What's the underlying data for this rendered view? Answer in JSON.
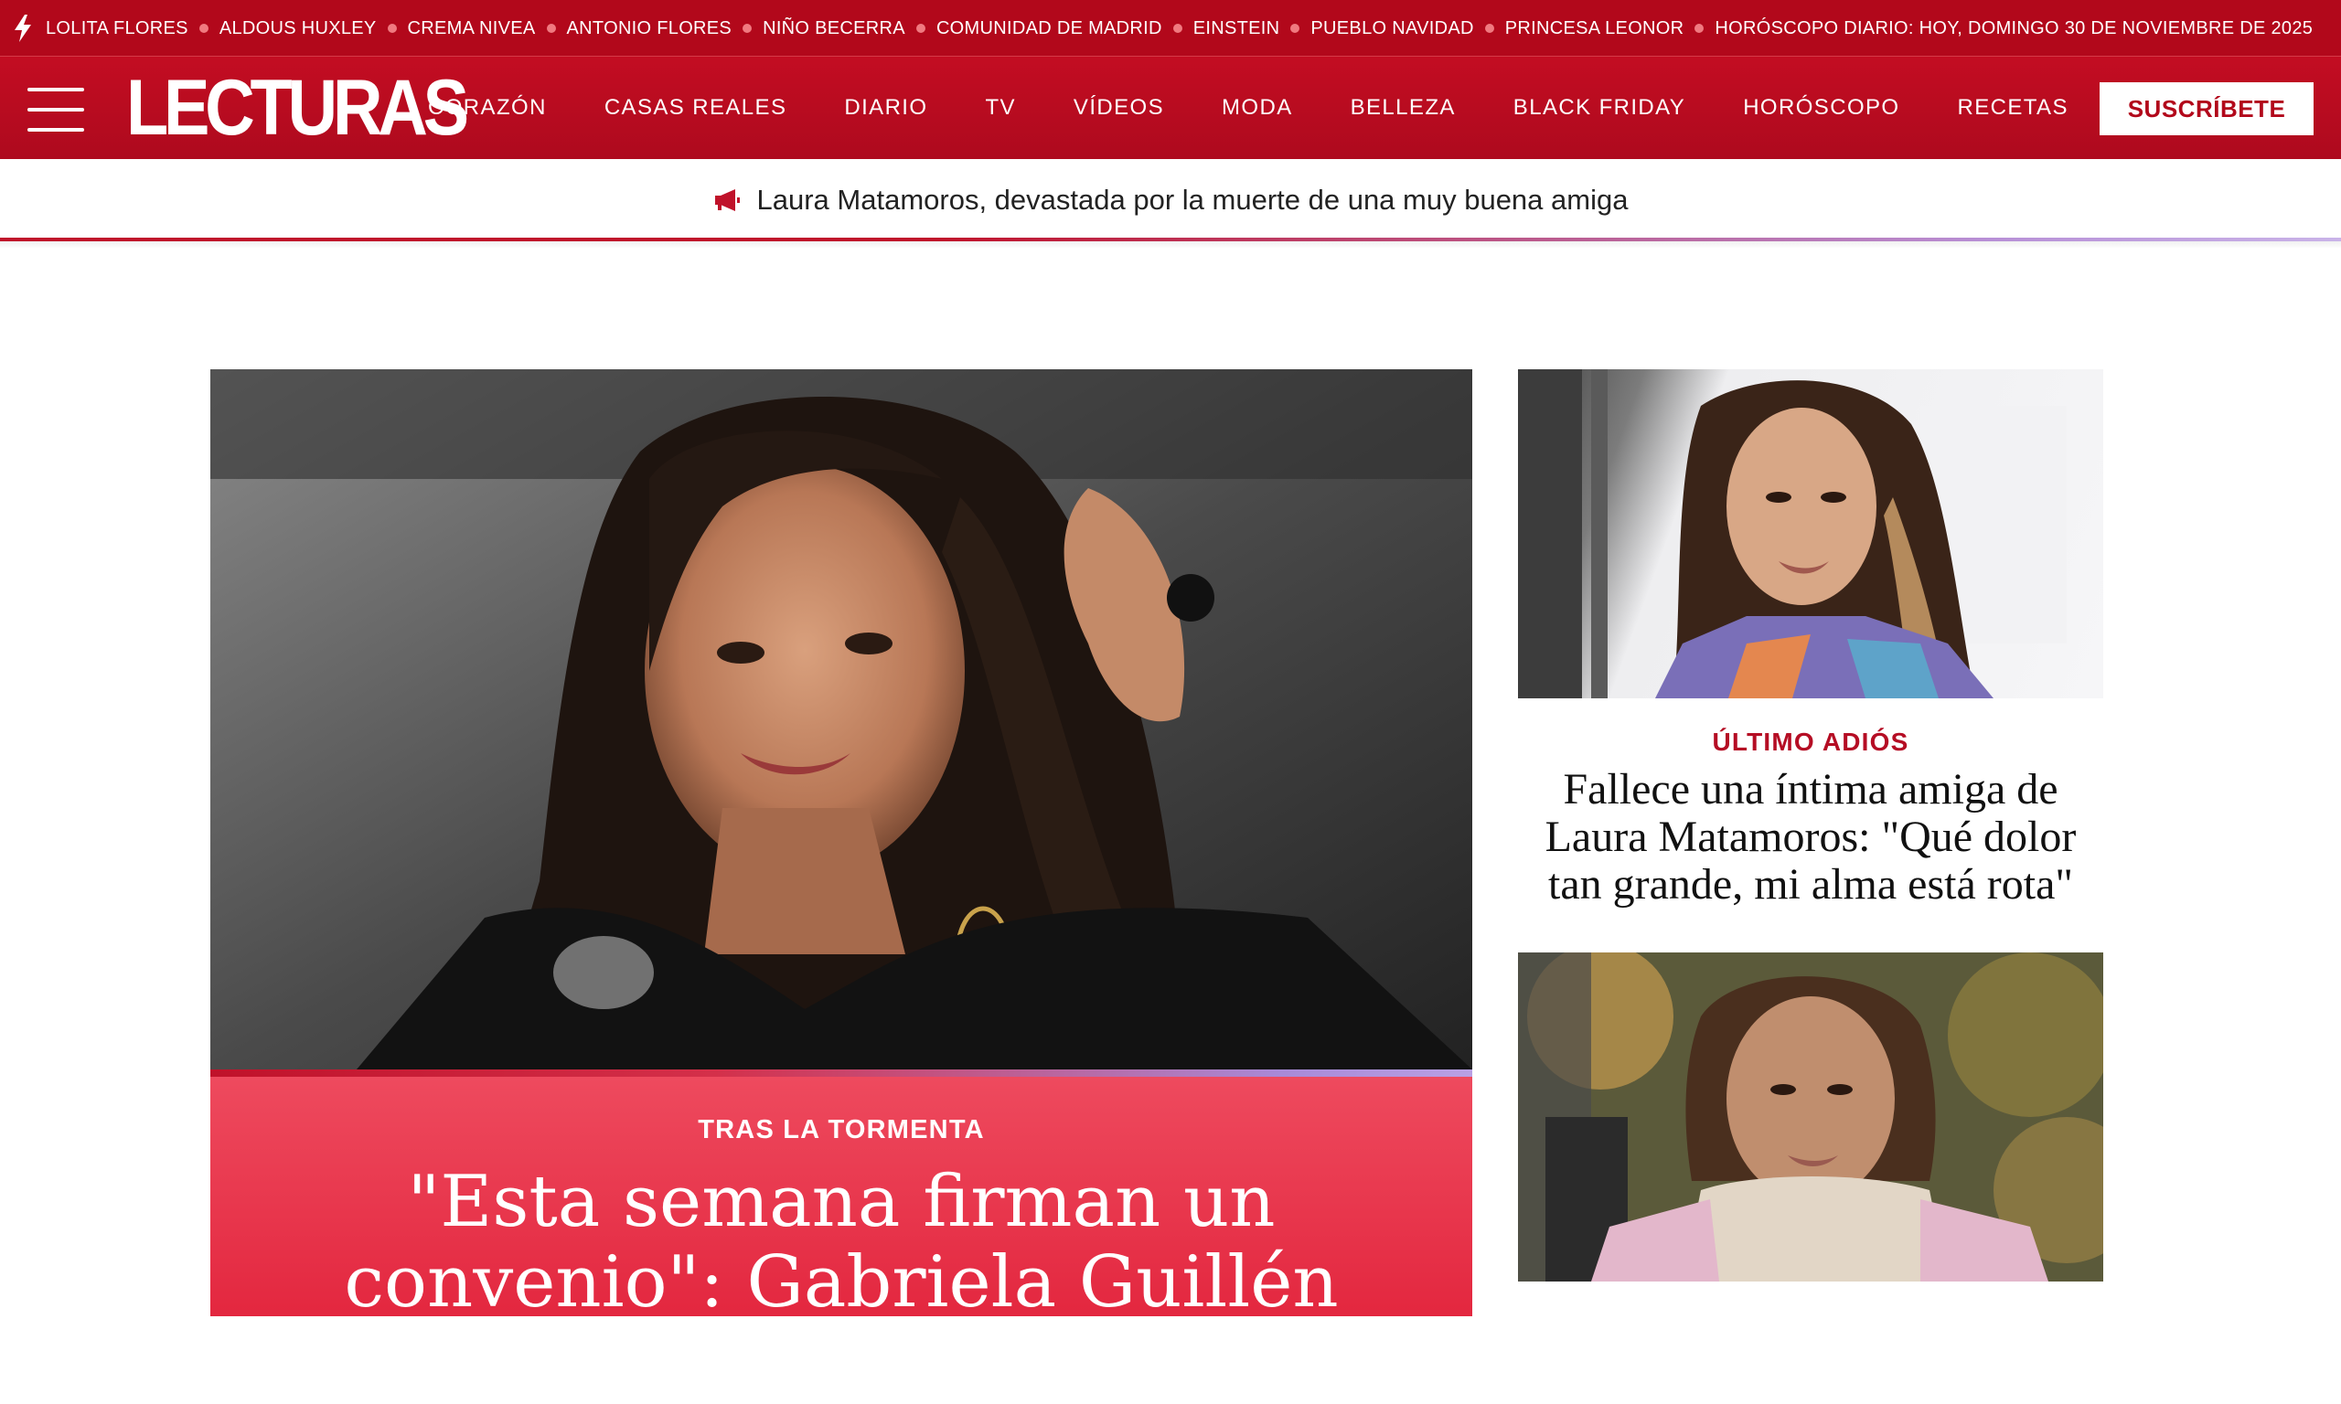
{
  "trending": {
    "items": [
      "LOLITA FLORES",
      "ALDOUS HUXLEY",
      "CREMA NIVEA",
      "ANTONIO FLORES",
      "NIÑO BECERRA",
      "COMUNIDAD DE MADRID",
      "EINSTEIN",
      "PUEBLO NAVIDAD",
      "PRINCESA LEONOR",
      "HORÓSCOPO DIARIO: HOY, DOMINGO 30 DE NOVIEMBRE DE 2025"
    ],
    "icon": "lightning-bolt-icon"
  },
  "header": {
    "logo": "LECTURAS",
    "nav": [
      "CORAZÓN",
      "CASAS REALES",
      "DIARIO",
      "TV",
      "VÍDEOS",
      "MODA",
      "BELLEZA",
      "BLACK FRIDAY",
      "HORÓSCOPO",
      "RECETAS"
    ],
    "subscribe_label": "SUSCRÍBETE",
    "menu_icon": "hamburger-menu-icon"
  },
  "breaking": {
    "icon": "megaphone-icon",
    "text": "Laura Matamoros, devastada por la muerte de una muy buena amiga"
  },
  "hero": {
    "kicker": "TRAS LA TORMENTA",
    "headline": "\"Esta semana firman un convenio\": Gabriela Guillén llega"
  },
  "side_cards": [
    {
      "kicker": "ÚLTIMO ADIÓS",
      "headline": "Fallece una íntima amiga de Laura Matamoros: \"Qué dolor tan grande, mi alma está rota\""
    },
    {
      "kicker": "",
      "headline": ""
    }
  ],
  "colors": {
    "brand_red": "#b2081b",
    "hero_red": "#e3273f",
    "accent_purple": "#a88ad8"
  }
}
